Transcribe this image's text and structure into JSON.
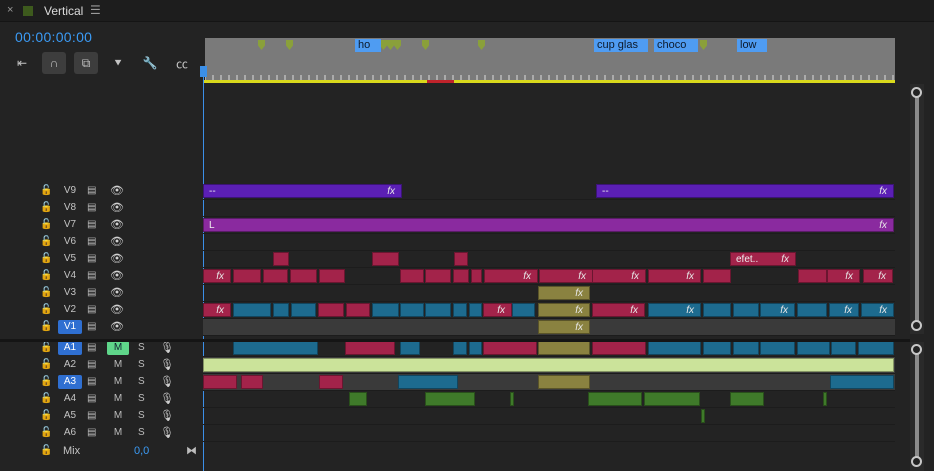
{
  "tab": {
    "close_glyph": "×",
    "title": "Vertical",
    "menu_glyph": "☰"
  },
  "timecode": "00:00:00:00",
  "tools": [
    {
      "name": "insert-icon",
      "glyph": "⇤",
      "active": false
    },
    {
      "name": "snap-icon",
      "glyph": "∩",
      "active": true
    },
    {
      "name": "linked-selection-icon",
      "glyph": "⧉",
      "active": true
    },
    {
      "name": "marker-icon",
      "glyph": "⯆",
      "active": false
    },
    {
      "name": "wrench-icon",
      "glyph": "🔧",
      "active": false
    },
    {
      "name": "captions-icon",
      "glyph": "㏄",
      "active": false
    }
  ],
  "marker_labels": [
    "ho",
    "cup glas",
    "choco",
    "low"
  ],
  "video_tracks": [
    {
      "name": "V9",
      "targeted": false
    },
    {
      "name": "V8",
      "targeted": false
    },
    {
      "name": "V7",
      "targeted": false
    },
    {
      "name": "V6",
      "targeted": false
    },
    {
      "name": "V5",
      "targeted": false
    },
    {
      "name": "V4",
      "targeted": false
    },
    {
      "name": "V3",
      "targeted": false
    },
    {
      "name": "V2",
      "targeted": false
    },
    {
      "name": "V1",
      "targeted": true
    }
  ],
  "audio_tracks": [
    {
      "name": "A1",
      "targeted": true,
      "mute": "M",
      "mute_on": true,
      "solo": "S"
    },
    {
      "name": "A2",
      "targeted": false,
      "mute": "M",
      "mute_on": false,
      "solo": "S"
    },
    {
      "name": "A3",
      "targeted": true,
      "mute": "M",
      "mute_on": false,
      "solo": "S"
    },
    {
      "name": "A4",
      "targeted": false,
      "mute": "M",
      "mute_on": false,
      "solo": "S"
    },
    {
      "name": "A5",
      "targeted": false,
      "mute": "M",
      "mute_on": false,
      "solo": "S"
    },
    {
      "name": "A6",
      "targeted": false,
      "mute": "M",
      "mute_on": false,
      "solo": "S"
    }
  ],
  "mix": {
    "label": "Mix",
    "value": "0,0"
  },
  "clip_labels": {
    "v9_a": "--",
    "v9_b": "--",
    "v7": "L",
    "v5_efet": "efet..",
    "fx": "fx"
  },
  "colors": {
    "accent": "#3b9bf5",
    "purple": "#5b1fb5",
    "magenta": "#8a2a9f",
    "crimson": "#a3234a",
    "teal": "#1d6b8f",
    "olive": "#8a8240",
    "audio_green": "#3f7a2a",
    "audio_light": "#cbe39a"
  }
}
